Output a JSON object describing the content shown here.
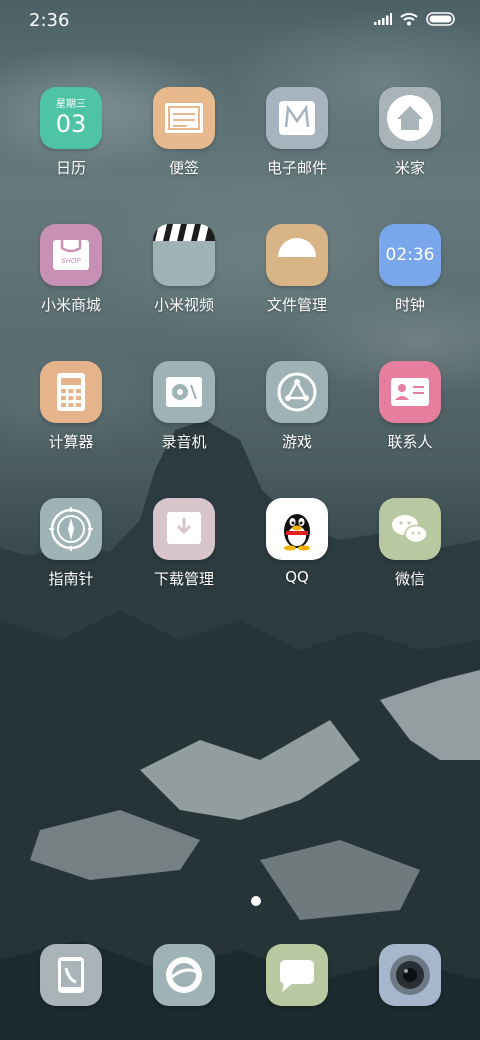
{
  "status_bar": {
    "time": "2:36"
  },
  "apps": [
    {
      "id": "calendar",
      "label": "日历",
      "icon": "calendar-icon",
      "color": "#4fc3a6",
      "weekday": "星期三",
      "day": "03"
    },
    {
      "id": "notes",
      "label": "便签",
      "icon": "notes-icon",
      "color": "#e8b98c"
    },
    {
      "id": "email",
      "label": "电子邮件",
      "icon": "email-icon",
      "color": "#a7b3be"
    },
    {
      "id": "mijia",
      "label": "米家",
      "icon": "mijia-home-icon",
      "color": "#a9b4b9"
    },
    {
      "id": "mi-store",
      "label": "小米商城",
      "icon": "shop-bag-icon",
      "color": "#c990b5",
      "shop_text": "SHOP"
    },
    {
      "id": "mi-video",
      "label": "小米视频",
      "icon": "clapperboard-icon",
      "color": "#9fb2b6"
    },
    {
      "id": "file-manager",
      "label": "文件管理",
      "icon": "folder-icon",
      "color": "#d9b486"
    },
    {
      "id": "clock",
      "label": "时钟",
      "icon": "clock-icon",
      "color": "#7aa7ec",
      "clock_text": "02:36"
    },
    {
      "id": "calculator",
      "label": "计算器",
      "icon": "calculator-icon",
      "color": "#e6b48b"
    },
    {
      "id": "recorder",
      "label": "录音机",
      "icon": "recorder-icon",
      "color": "#9fb2b6"
    },
    {
      "id": "games",
      "label": "游戏",
      "icon": "games-icon",
      "color": "#9fb2b6"
    },
    {
      "id": "contacts",
      "label": "联系人",
      "icon": "contact-card-icon",
      "color": "#e57f9d"
    },
    {
      "id": "compass",
      "label": "指南针",
      "icon": "compass-icon",
      "color": "#9fb2b6"
    },
    {
      "id": "downloads",
      "label": "下载管理",
      "icon": "download-icon",
      "color": "#d8c4cb"
    },
    {
      "id": "qq",
      "label": "QQ",
      "icon": "qq-penguin-icon",
      "color": "#ffffff"
    },
    {
      "id": "wechat",
      "label": "微信",
      "icon": "wechat-icon",
      "color": "#b8c9a2"
    }
  ],
  "dock": [
    {
      "id": "phone",
      "icon": "phone-icon",
      "color": "#a9b4b9"
    },
    {
      "id": "browser",
      "icon": "browser-icon",
      "color": "#9fb2b6"
    },
    {
      "id": "messages",
      "icon": "messages-icon",
      "color": "#b8c9a2"
    },
    {
      "id": "camera",
      "icon": "camera-icon",
      "color": "#a6b6cc"
    }
  ]
}
